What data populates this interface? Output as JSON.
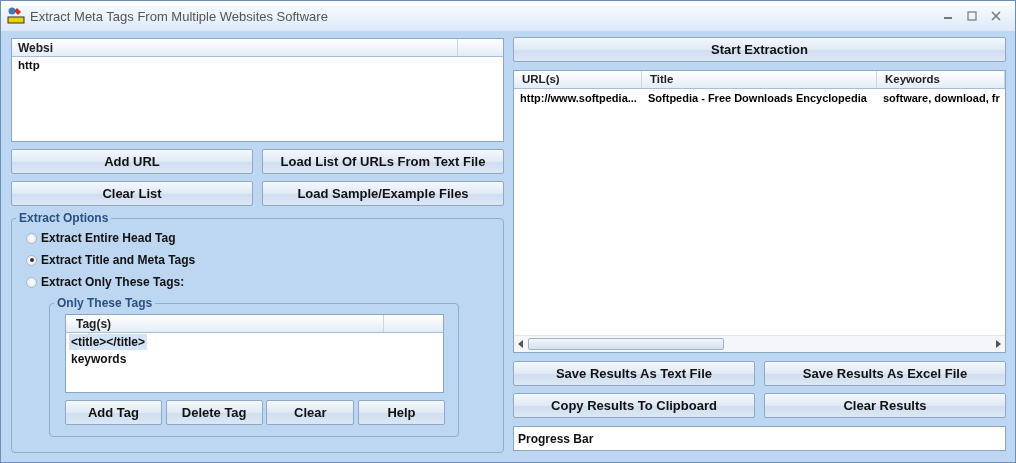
{
  "window": {
    "title": "Extract Meta Tags From Multiple Websites Software"
  },
  "website_list": {
    "columns": [
      "Websi"
    ],
    "rows": [
      "http"
    ]
  },
  "list_buttons": [
    "Add URL",
    "Load List Of URLs From Text File",
    "Clear List",
    "Load Sample/Example Files"
  ],
  "extract_options": {
    "title": "Extract Options",
    "options": [
      {
        "label": "Extract Entire Head Tag",
        "selected": false
      },
      {
        "label": "Extract Title and Meta Tags",
        "selected": true
      },
      {
        "label": "Extract Only These Tags:",
        "selected": false
      }
    ],
    "only_these_tags": {
      "title": "Only These Tags",
      "column": "Tag(s)",
      "tags": [
        {
          "text": "<title></title>",
          "selected": true
        },
        {
          "text": "keywords",
          "selected": false
        }
      ],
      "buttons": [
        "Add Tag",
        "Delete Tag",
        "Clear",
        "Help"
      ]
    }
  },
  "start_button": "Start Extraction",
  "results": {
    "columns": [
      "URL(s)",
      "Title",
      "Keywords"
    ],
    "rows": [
      [
        "http://www.softpedia...",
        "Softpedia - Free Downloads Encyclopedia",
        "software, download, fr"
      ]
    ]
  },
  "result_buttons": [
    "Save Results As Text File",
    "Save Results As Excel File",
    "Copy Results To Clipboard",
    "Clear Results"
  ],
  "progress": {
    "label": "Progress Bar"
  }
}
